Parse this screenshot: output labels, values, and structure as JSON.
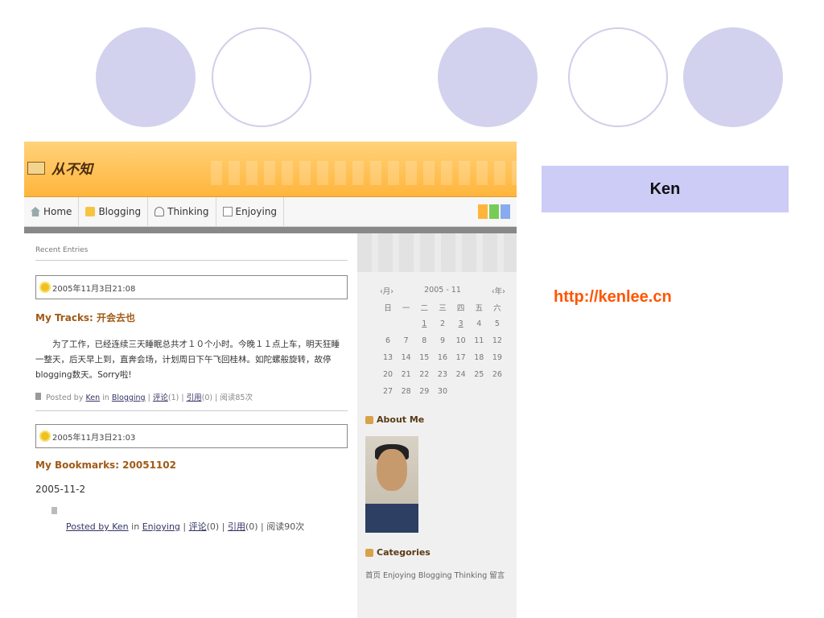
{
  "site": {
    "title": "从不知"
  },
  "nav": {
    "items": [
      "Home",
      "Blogging",
      "Thinking",
      "Enjoying"
    ],
    "swatch_colors": [
      "#ffb53c",
      "#77cc55",
      "#88aaee"
    ]
  },
  "main": {
    "recent_label": "Recent Entries",
    "entries": [
      {
        "date": "2005年11月3日21:08",
        "title": "My Tracks: 开会去也",
        "body": "为了工作，已经连续三天睡眠总共才１０个小时。今晚１１点上车，明天狂睡一整天，后天早上到，直奔会场，计划周日下午飞回桂林。如陀螺般旋转，故停blogging数天。Sorry啦!",
        "meta": {
          "posted_by": "Posted by",
          "author": "Ken",
          "in": "in",
          "category": "Blogging",
          "comments": "评论",
          "comments_count": "(1)",
          "sep": "|",
          "trackback": "引用",
          "trackback_count": "(0)",
          "reads": "阅读85次"
        }
      },
      {
        "date": "2005年11月3日21:03",
        "title": "My Bookmarks: 20051102",
        "date_line": "2005-11-2",
        "meta": {
          "posted_by_author": "Posted by Ken",
          "in": "in",
          "category": "Enjoying",
          "comments": "评论",
          "comments_count": "(0)",
          "trackback": "引用",
          "trackback_count": "(0)",
          "reads": "阅读90次"
        }
      }
    ]
  },
  "sidebar": {
    "calendar": {
      "prev_month": "‹月›",
      "month": "2005 - 11",
      "prev_year": "‹年›",
      "weekdays": [
        "日",
        "一",
        "二",
        "三",
        "四",
        "五",
        "六"
      ],
      "weeks": [
        [
          "",
          "",
          "1",
          "2",
          "3",
          "4",
          "5"
        ],
        [
          "6",
          "7",
          "8",
          "9",
          "10",
          "11",
          "12"
        ],
        [
          "13",
          "14",
          "15",
          "16",
          "17",
          "18",
          "19"
        ],
        [
          "20",
          "21",
          "22",
          "23",
          "24",
          "25",
          "26"
        ],
        [
          "27",
          "28",
          "29",
          "30",
          "",
          "",
          ""
        ]
      ]
    },
    "about_title": "About Me",
    "categories_title": "Categories",
    "categories_text": "首页 Enjoying Blogging Thinking 留言"
  },
  "panel": {
    "author_name": "Ken",
    "author_url": "http://kenlee.cn"
  }
}
